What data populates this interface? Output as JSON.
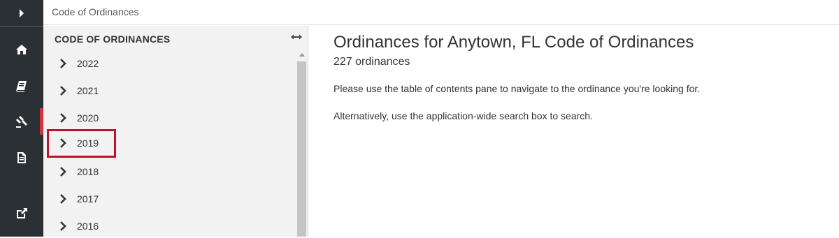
{
  "breadcrumb": {
    "label": "Code of Ordinances"
  },
  "rail": {
    "icons": [
      "expand-arrow-icon",
      "home-icon",
      "book-icon",
      "gavel-icon",
      "document-icon",
      "external-link-icon"
    ],
    "active_color": "#d4343b"
  },
  "toc": {
    "header": "CODE OF ORDINANCES",
    "items": [
      {
        "label": "2022"
      },
      {
        "label": "2021"
      },
      {
        "label": "2020"
      },
      {
        "label": "2019",
        "selected": true
      },
      {
        "label": "2018"
      },
      {
        "label": "2017"
      },
      {
        "label": "2016"
      }
    ]
  },
  "main": {
    "title": "Ordinances for Anytown, FL Code of Ordinances",
    "count": "227 ordinances",
    "paragraph1": "Please use the table of contents pane to navigate to the ordinance you're looking for.",
    "paragraph2": "Alternatively, use the application-wide search box to search."
  },
  "colors": {
    "rail_bg": "#2b3035",
    "highlight": "#c0102c",
    "toc_bg": "#f2f2f2"
  }
}
